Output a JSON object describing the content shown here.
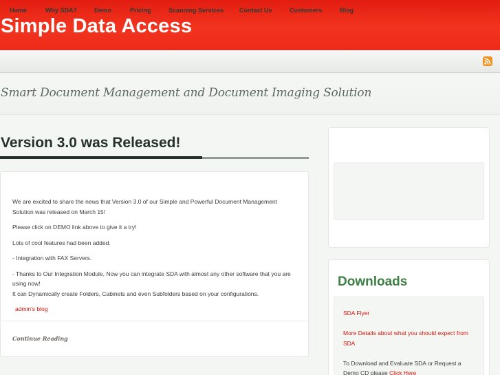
{
  "header": {
    "site_title": "Simple Data Access"
  },
  "nav": {
    "items": [
      "Home",
      "Why SDA?",
      "Demo",
      "Pricing",
      "Scanning Services",
      "Contact Us",
      "Customers",
      "Blog"
    ],
    "rss_icon": "rss-feed-icon"
  },
  "tagline": "Smart Document Management and Document Imaging Solution",
  "post": {
    "title": "Version 3.0 was Released!",
    "lines": [
      "We are excited to share the news that Version 3.0 of our Simple and Powerful Document Management",
      "Solution was released on March 15!",
      "Please click on DEMO link above to give it a try!",
      "Lots of cool features had been added.",
      "- Integration with FAX Servers.",
      "- Thanks to Our Integration Module, Now you can integrate SDA with almost any other software that you are",
      "using now!",
      "It can Dynamically create Folders, Cabinets and even Subfolders based on your configurations."
    ],
    "author_link": "admin's blog",
    "continue_link": "Continue Reading"
  },
  "sidebar": {
    "downloads_title": "Downloads",
    "links": [
      "SDA Flyer",
      "More Details about what you should expect from",
      "SDA"
    ],
    "text_line_1": "To Download and Evaluate SDA or Request a",
    "text_line_2_prefix": "Demo CD please ",
    "text_line_2_link": "Click Here"
  },
  "colors": {
    "header_red": "#ef2a18",
    "link_red": "#d3150b",
    "downloads_green": "#3e7f44"
  }
}
